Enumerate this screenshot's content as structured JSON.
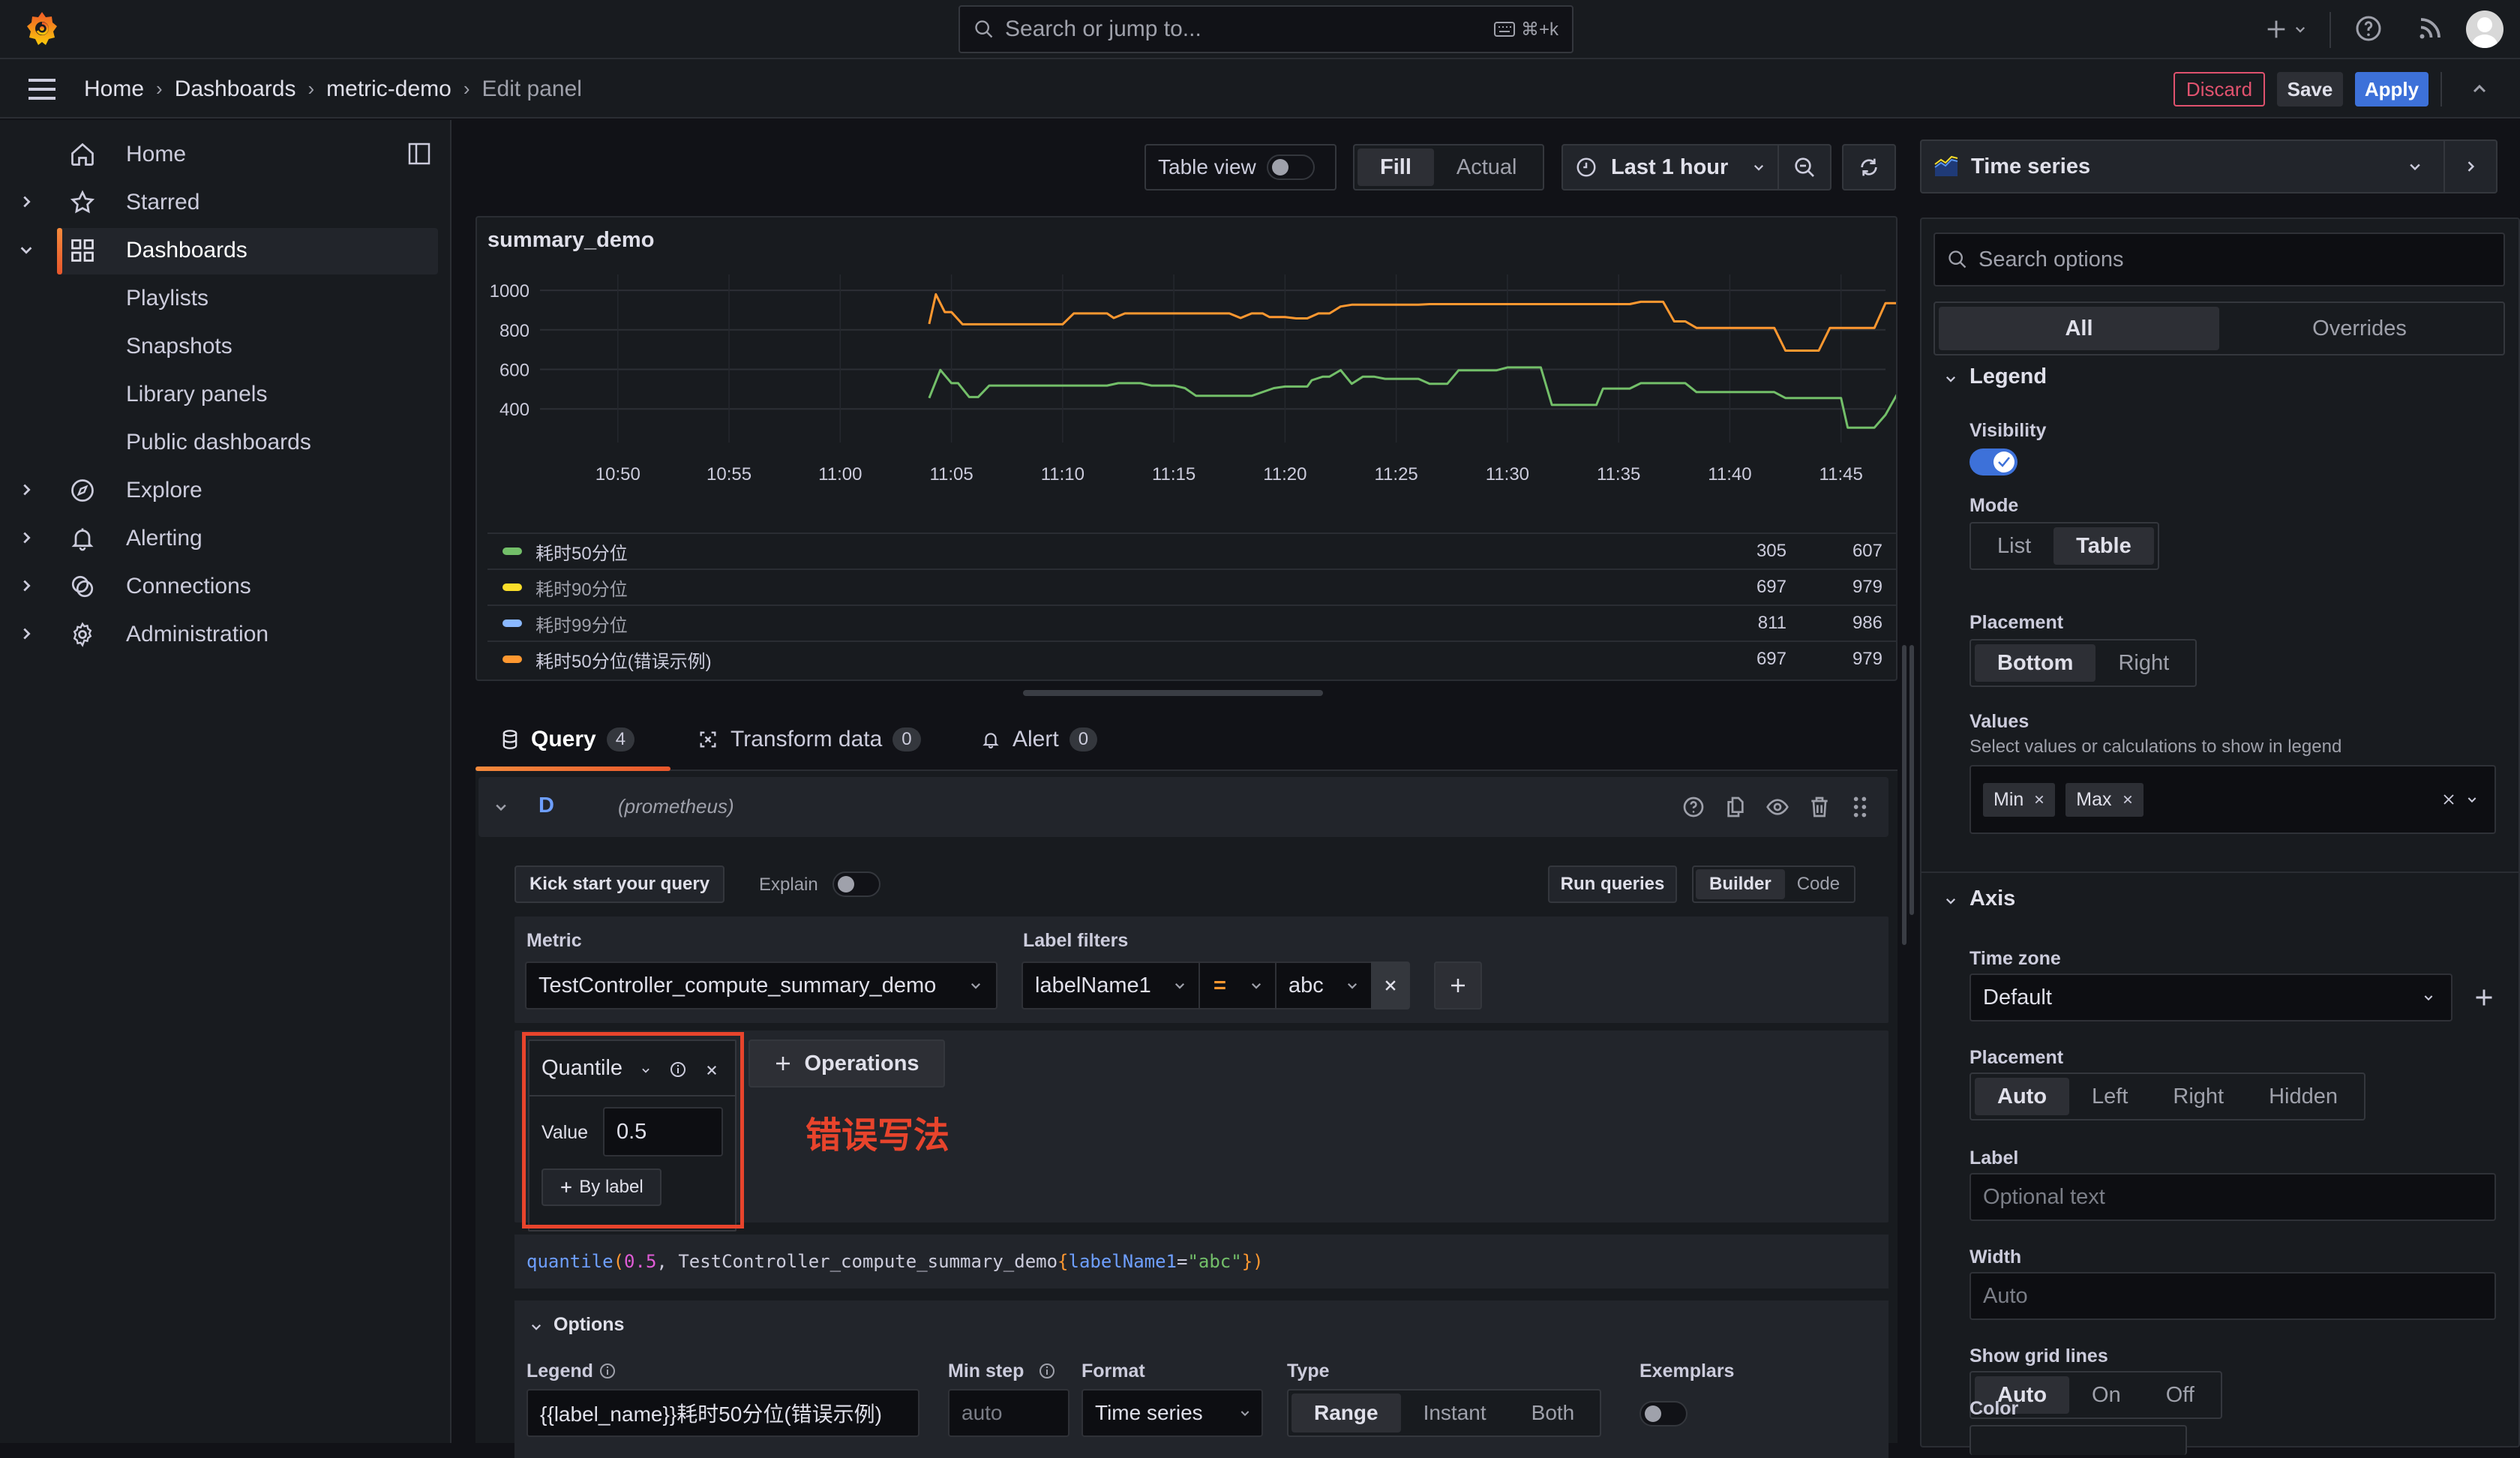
{
  "topbar": {
    "search_placeholder": "Search or jump to...",
    "search_shortcut": "⌘+k",
    "icons": [
      "grafana-logo-icon",
      "search-icon",
      "keyboard-icon",
      "plus-icon",
      "chevron-down-icon",
      "help-icon",
      "rss-icon",
      "avatar"
    ]
  },
  "breadcrumb": {
    "items": [
      "Home",
      "Dashboards",
      "metric-demo",
      "Edit panel"
    ],
    "separator": "›"
  },
  "actions": {
    "discard": "Discard",
    "save": "Save",
    "apply": "Apply"
  },
  "sidebar": {
    "items": [
      {
        "label": "Home",
        "icon": "home-icon",
        "expandable": false
      },
      {
        "label": "Starred",
        "icon": "star-icon",
        "expandable": true
      },
      {
        "label": "Dashboards",
        "icon": "dashboards-icon",
        "expandable": true,
        "expanded": true,
        "active": true
      },
      {
        "label": "Explore",
        "icon": "compass-icon",
        "expandable": true
      },
      {
        "label": "Alerting",
        "icon": "bell-icon",
        "expandable": true
      },
      {
        "label": "Connections",
        "icon": "connections-icon",
        "expandable": true
      },
      {
        "label": "Administration",
        "icon": "gear-icon",
        "expandable": true
      }
    ],
    "subitems": [
      "Playlists",
      "Snapshots",
      "Library panels",
      "Public dashboards"
    ]
  },
  "panel_toolbar": {
    "table_view": "Table view",
    "fill": "Fill",
    "actual": "Actual",
    "time_range": "Last 1 hour"
  },
  "panel": {
    "title": "summary_demo"
  },
  "chart_data": {
    "type": "line",
    "title": "summary_demo",
    "xlabel": "",
    "ylabel": "",
    "x_ticks": [
      "10:50",
      "10:55",
      "11:00",
      "11:05",
      "11:10",
      "11:15",
      "11:20",
      "11:25",
      "11:30",
      "11:35",
      "11:40",
      "11:45"
    ],
    "y_ticks": [
      400,
      600,
      800,
      1000
    ],
    "ylim": [
      230,
      1080
    ],
    "xlim_minutes": [
      46.5,
      107
    ],
    "x_unit": "minutes since 10:00",
    "grid": true,
    "legend": {
      "mode": "table",
      "placement": "bottom",
      "columns": [
        "Min",
        "Max"
      ]
    },
    "series": [
      {
        "name": "耗时50分位",
        "color": "#73bf69",
        "min": 305,
        "max": 607,
        "points": [
          [
            64,
            455
          ],
          [
            64.5,
            597
          ],
          [
            65,
            530
          ],
          [
            65.3,
            530
          ],
          [
            65.8,
            460
          ],
          [
            66.2,
            460
          ],
          [
            66.7,
            518
          ],
          [
            72,
            518
          ],
          [
            72.5,
            530
          ],
          [
            73.5,
            530
          ],
          [
            74,
            518
          ],
          [
            75,
            518
          ],
          [
            75.5,
            505
          ],
          [
            76,
            466
          ],
          [
            78.5,
            466
          ],
          [
            79.5,
            505
          ],
          [
            80,
            513
          ],
          [
            81,
            513
          ],
          [
            81.2,
            545
          ],
          [
            81.7,
            563
          ],
          [
            82,
            563
          ],
          [
            82.5,
            596
          ],
          [
            83,
            527
          ],
          [
            83.5,
            563
          ],
          [
            84,
            563
          ],
          [
            84.5,
            552
          ],
          [
            86,
            552
          ],
          [
            86.5,
            527
          ],
          [
            87.3,
            527
          ],
          [
            87.8,
            595
          ],
          [
            89.5,
            595
          ],
          [
            90,
            610
          ],
          [
            91.5,
            610
          ],
          [
            92,
            420
          ],
          [
            94,
            420
          ],
          [
            94.3,
            503
          ],
          [
            95.5,
            503
          ],
          [
            96,
            530
          ],
          [
            98,
            530
          ],
          [
            98.5,
            485
          ],
          [
            102,
            485
          ],
          [
            102.5,
            455
          ],
          [
            105,
            455
          ],
          [
            105.3,
            305
          ],
          [
            106.5,
            305
          ],
          [
            107,
            370
          ],
          [
            107.5,
            470
          ],
          [
            108,
            460
          ],
          [
            108.5,
            470
          ],
          [
            113,
            470
          ],
          [
            113.5,
            483
          ],
          [
            119,
            483
          ],
          [
            119.5,
            470
          ],
          [
            120,
            470
          ]
        ]
      },
      {
        "name": "耗时90分位",
        "color": "#fade2a",
        "min": 697,
        "max": 979,
        "hidden_in_plot": true
      },
      {
        "name": "耗时99分位",
        "color": "#8ab8ff",
        "min": 811,
        "max": 986,
        "hidden_in_plot": true
      },
      {
        "name": "耗时50分位(错误示例)",
        "color": "#ff9830",
        "min": 697,
        "max": 979,
        "points": [
          [
            64,
            830
          ],
          [
            64.3,
            980
          ],
          [
            64.7,
            890
          ],
          [
            65,
            890
          ],
          [
            65.5,
            828
          ],
          [
            70,
            828
          ],
          [
            70.5,
            883
          ],
          [
            72,
            883
          ],
          [
            72.3,
            860
          ],
          [
            72.8,
            883
          ],
          [
            77.5,
            883
          ],
          [
            78,
            860
          ],
          [
            78.5,
            883
          ],
          [
            79,
            883
          ],
          [
            79.3,
            865
          ],
          [
            80,
            865
          ],
          [
            80.5,
            858
          ],
          [
            81,
            858
          ],
          [
            81.5,
            883
          ],
          [
            82,
            883
          ],
          [
            82.5,
            918
          ],
          [
            83,
            927
          ],
          [
            86,
            927
          ],
          [
            86.5,
            930
          ],
          [
            95.5,
            930
          ],
          [
            96,
            942
          ],
          [
            97,
            942
          ],
          [
            97.5,
            843
          ],
          [
            98,
            843
          ],
          [
            98.5,
            810
          ],
          [
            102,
            810
          ],
          [
            102.5,
            695
          ],
          [
            104,
            695
          ],
          [
            104.5,
            810
          ],
          [
            106.5,
            810
          ],
          [
            107,
            935
          ],
          [
            109,
            935
          ],
          [
            109.3,
            850
          ],
          [
            109.7,
            935
          ],
          [
            110,
            915
          ],
          [
            114.5,
            915
          ],
          [
            115,
            890
          ],
          [
            120,
            890
          ]
        ]
      }
    ]
  },
  "legend_rows": [
    {
      "name": "耗时50分位",
      "color": "#73bf69",
      "min": "305",
      "max": "607"
    },
    {
      "name": "耗时90分位",
      "color": "#fade2a",
      "min": "697",
      "max": "979"
    },
    {
      "name": "耗时99分位",
      "color": "#8ab8ff",
      "min": "811",
      "max": "986"
    },
    {
      "name": "耗时50分位(错误示例)",
      "color": "#ff9830",
      "min": "697",
      "max": "979"
    }
  ],
  "tabs": [
    {
      "label": "Query",
      "count": "4",
      "active": true,
      "icon": "database-icon"
    },
    {
      "label": "Transform data",
      "count": "0",
      "icon": "transform-icon"
    },
    {
      "label": "Alert",
      "count": "0",
      "icon": "bell-icon"
    }
  ],
  "query": {
    "ref_id": "D",
    "datasource": "(prometheus)",
    "kick_start": "Kick start your query",
    "explain": "Explain",
    "run_queries": "Run queries",
    "builder": "Builder",
    "code": "Code",
    "metric_label": "Metric",
    "metric_value": "TestController_compute_summary_demo",
    "label_filters_label": "Label filters",
    "filter_label": "labelName1",
    "filter_op": "=",
    "filter_value": "abc",
    "operation_name": "Quantile",
    "value_label": "Value",
    "value": "0.5",
    "by_label": "By label",
    "operations_btn": "Operations",
    "annotation": "错误写法",
    "promql": {
      "fn": "quantile",
      "arg": "0.5",
      "metric": "TestController_compute_summary_demo",
      "label": "labelName1",
      "value": "\"abc\""
    },
    "options_title": "Options",
    "legend_label": "Legend",
    "legend_value": "{{label_name}}耗时50分位(错误示例)",
    "min_step_label": "Min step",
    "min_step_placeholder": "auto",
    "format_label": "Format",
    "format_value": "Time series",
    "type_label": "Type",
    "type_options": [
      "Range",
      "Instant",
      "Both"
    ],
    "type_selected": "Range",
    "exemplars_label": "Exemplars"
  },
  "options_pane": {
    "viz": "Time series",
    "search_placeholder": "Search options",
    "tab_all": "All",
    "tab_overrides": "Overrides",
    "legend_section": "Legend",
    "visibility_label": "Visibility",
    "visibility_on": true,
    "mode_label": "Mode",
    "mode_options": [
      "List",
      "Table"
    ],
    "mode_selected": "Table",
    "placement_label": "Placement",
    "placement_options": [
      "Bottom",
      "Right"
    ],
    "placement_selected": "Bottom",
    "values_label": "Values",
    "values_desc": "Select values or calculations to show in legend",
    "values_chips": [
      "Min",
      "Max"
    ],
    "axis_section": "Axis",
    "timezone_label": "Time zone",
    "timezone_value": "Default",
    "axis_placement_label": "Placement",
    "axis_placement_options": [
      "Auto",
      "Left",
      "Right",
      "Hidden"
    ],
    "axis_placement_selected": "Auto",
    "axis_label_label": "Label",
    "axis_label_placeholder": "Optional text",
    "width_label": "Width",
    "width_placeholder": "Auto",
    "grid_label": "Show grid lines",
    "grid_options": [
      "Auto",
      "On",
      "Off"
    ],
    "grid_selected": "Auto",
    "color_label": "Color"
  },
  "colors": {
    "accent_blue": "#3d71d9",
    "discard_red": "#e0526e",
    "annotation_red": "#e8442c",
    "active_orange": "#f58a3c"
  }
}
